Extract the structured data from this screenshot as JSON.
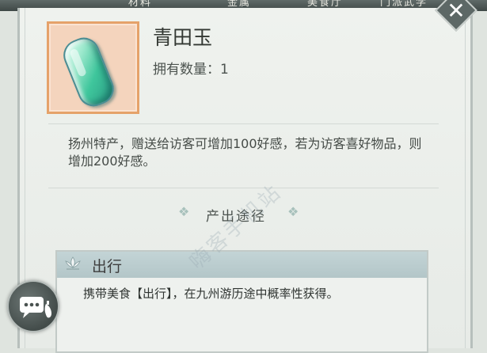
{
  "tabs": [
    "材料",
    "金属",
    "美食厅",
    "门派武学"
  ],
  "item": {
    "name": "青田玉",
    "owned_label": "拥有数量：",
    "owned_count": "1",
    "description": "扬州特产，赠送给访客可增加100好感，若为访客喜好物品，则增加200好感。"
  },
  "section": {
    "diamond_left": "❖",
    "title": "产出途径",
    "diamond_right": "❖"
  },
  "source": {
    "title": "出行",
    "text": "携带美食【出行】，在九州游历途中概率性获得。"
  },
  "watermark": "嗨客手机站",
  "colors": {
    "icon_frame_border": "#e5a26a",
    "icon_frame_fill": "#f4d4bd",
    "card_header": "#b9cbcd",
    "panel_bg": "#eef1ee"
  },
  "icons": [
    "close-icon",
    "chat-icon",
    "lotus-icon",
    "jade-item-icon"
  ]
}
